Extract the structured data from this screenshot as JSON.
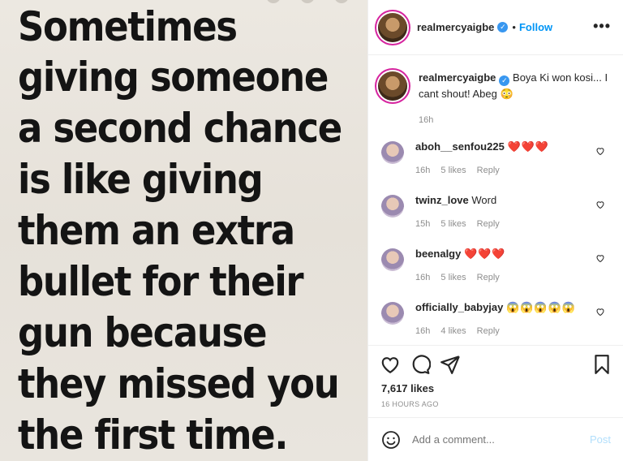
{
  "image": {
    "quote_lines": [
      "Sometimes",
      "giving someone",
      "a second chance",
      "is like giving",
      "them an extra",
      "bullet for their",
      "gun because",
      "they missed you",
      "the first time."
    ]
  },
  "header": {
    "username": "realmercyaigbe",
    "follow_label": "Follow",
    "more_icon": "more-horizontal-icon"
  },
  "caption": {
    "username": "realmercyaigbe",
    "text": "Boya Ki won kosi... I cant shout! Abeg 😳",
    "time": "16h"
  },
  "comments": [
    {
      "username": "aboh__senfou225",
      "text": "❤️❤️❤️",
      "time": "16h",
      "likes": "5 likes",
      "reply": "Reply"
    },
    {
      "username": "twinz_love",
      "text": "Word",
      "time": "15h",
      "likes": "5 likes",
      "reply": "Reply"
    },
    {
      "username": "beenalgy",
      "text": "❤️❤️❤️",
      "time": "16h",
      "likes": "5 likes",
      "reply": "Reply"
    },
    {
      "username": "officially_babyjay",
      "text": "😱😱😱😱😱",
      "time": "16h",
      "likes": "4 likes",
      "reply": "Reply"
    }
  ],
  "actions": {
    "likes": "7,617 likes",
    "timestamp": "16 HOURS AGO"
  },
  "add_comment": {
    "placeholder": "Add a comment...",
    "post_label": "Post"
  },
  "colors": {
    "accent": "#0095f6",
    "heart": "#e0245e"
  }
}
